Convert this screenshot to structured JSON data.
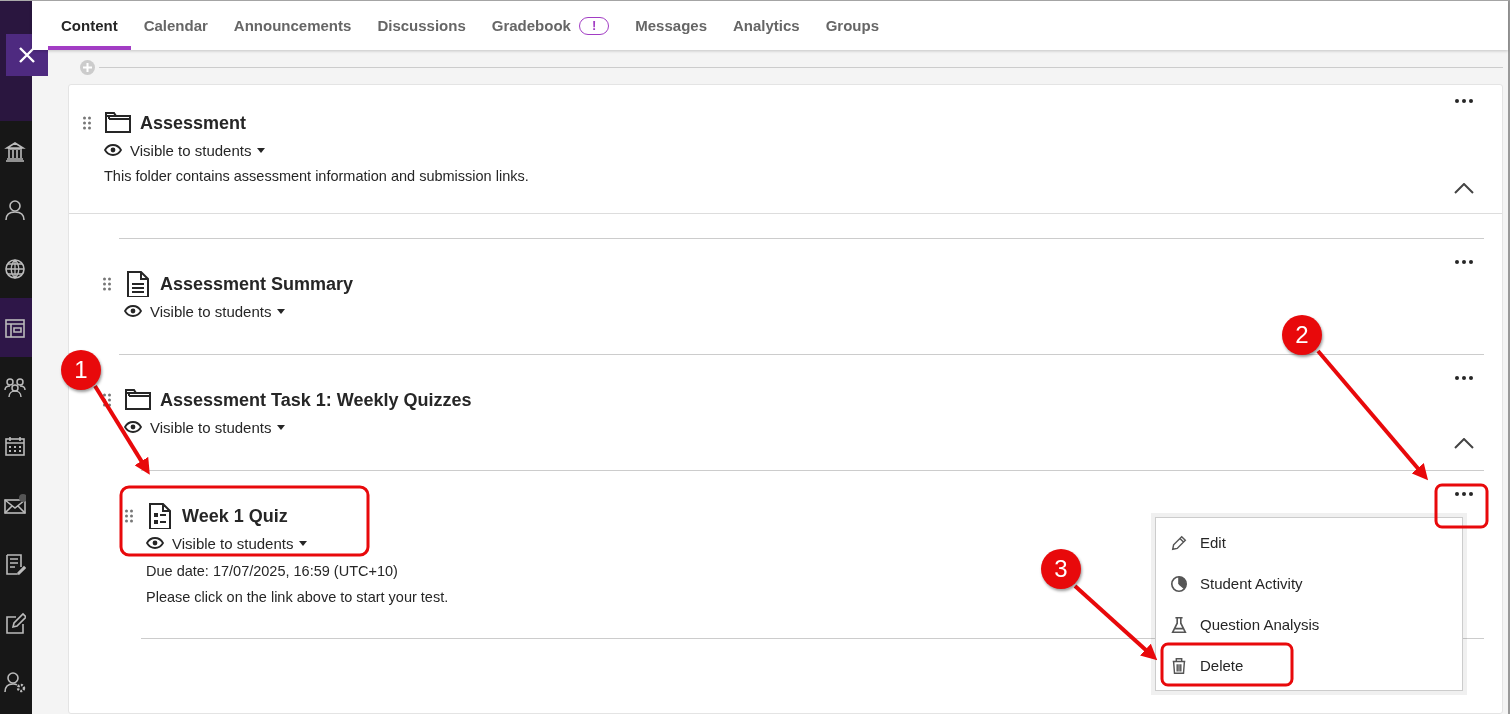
{
  "nav_rail": {
    "items": [
      {
        "selected": false
      },
      {
        "selected": false
      },
      {
        "selected": false
      },
      {
        "selected": true
      },
      {
        "selected": false
      },
      {
        "selected": false
      },
      {
        "selected": false
      },
      {
        "selected": false
      },
      {
        "selected": false
      },
      {
        "selected": false
      }
    ]
  },
  "tabs": [
    {
      "label": "Content",
      "selected": true
    },
    {
      "label": "Calendar",
      "selected": false
    },
    {
      "label": "Announcements",
      "selected": false
    },
    {
      "label": "Discussions",
      "selected": false
    },
    {
      "label": "Gradebook",
      "selected": false,
      "badge": "!"
    },
    {
      "label": "Messages",
      "selected": false
    },
    {
      "label": "Analytics",
      "selected": false
    },
    {
      "label": "Groups",
      "selected": false
    }
  ],
  "content": {
    "items": [
      {
        "kind": "folder",
        "title": "Assessment",
        "visibility": "Visible to students",
        "details": [
          "This folder contains assessment information and submission links."
        ],
        "expanded": true,
        "children": [
          {
            "kind": "document",
            "title": "Assessment Summary",
            "visibility": "Visible to students"
          },
          {
            "kind": "folder",
            "title": "Assessment Task 1: Weekly Quizzes",
            "visibility": "Visible to students",
            "expanded": true,
            "children": [
              {
                "kind": "test",
                "title": "Week 1 Quiz",
                "visibility": "Visible to students",
                "details": [
                  "Due date: 17/07/2025, 16:59 (UTC+10)",
                  "Please click on the link above to start your test."
                ]
              }
            ]
          }
        ]
      }
    ]
  },
  "context_menu": {
    "items": [
      {
        "label": "Edit"
      },
      {
        "label": "Student Activity"
      },
      {
        "label": "Question Analysis"
      },
      {
        "label": "Delete"
      }
    ]
  },
  "callouts": [
    {
      "label": "1"
    },
    {
      "label": "2"
    },
    {
      "label": "3"
    }
  ]
}
